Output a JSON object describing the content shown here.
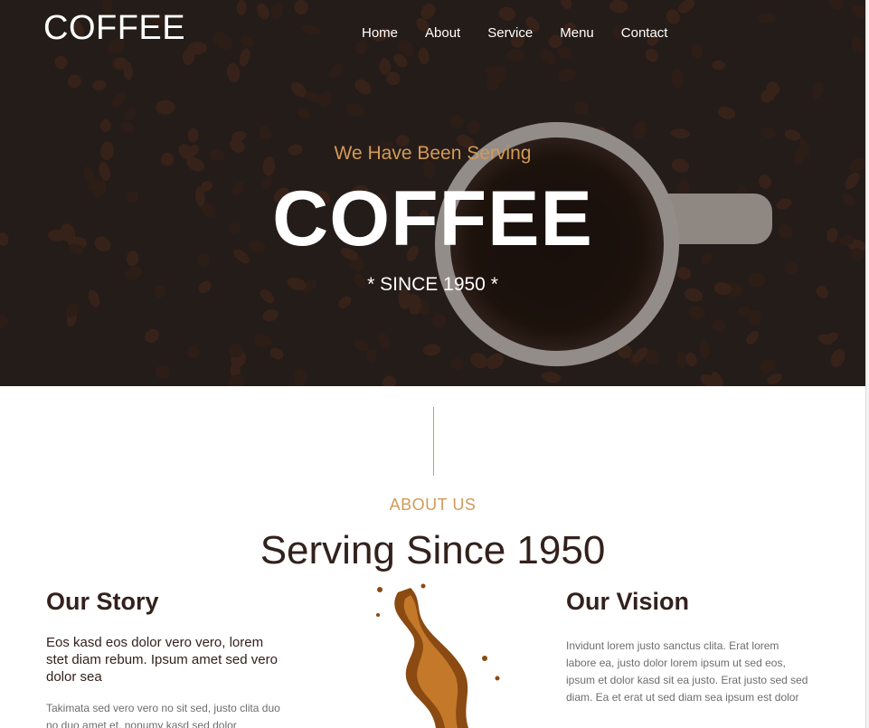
{
  "header": {
    "brand": "COFFEE",
    "nav": [
      "Home",
      "About",
      "Service",
      "Menu",
      "Contact"
    ]
  },
  "hero": {
    "subtitle": "We Have Been Serving",
    "title": "COFFEE",
    "since": "* SINCE 1950 *"
  },
  "about": {
    "label": "ABOUT US",
    "title": "Serving Since 1950",
    "story": {
      "title": "Our Story",
      "lead": "Eos kasd eos dolor vero vero, lorem stet diam rebum. Ipsum amet sed vero dolor sea",
      "text": "Takimata sed vero vero no sit sed, justo clita duo no duo amet et, nonumy kasd sed dolor"
    },
    "vision": {
      "title": "Our Vision",
      "text": "Invidunt lorem justo sanctus clita. Erat lorem labore ea, justo dolor lorem ipsum ut sed eos, ipsum et dolor kasd sit ea justo. Erat justo sed sed diam. Ea et erat ut sed diam sea ipsum est dolor"
    }
  },
  "colors": {
    "accent": "#d39a57",
    "dark": "#33211d",
    "hero_bg": "#2a2220"
  }
}
